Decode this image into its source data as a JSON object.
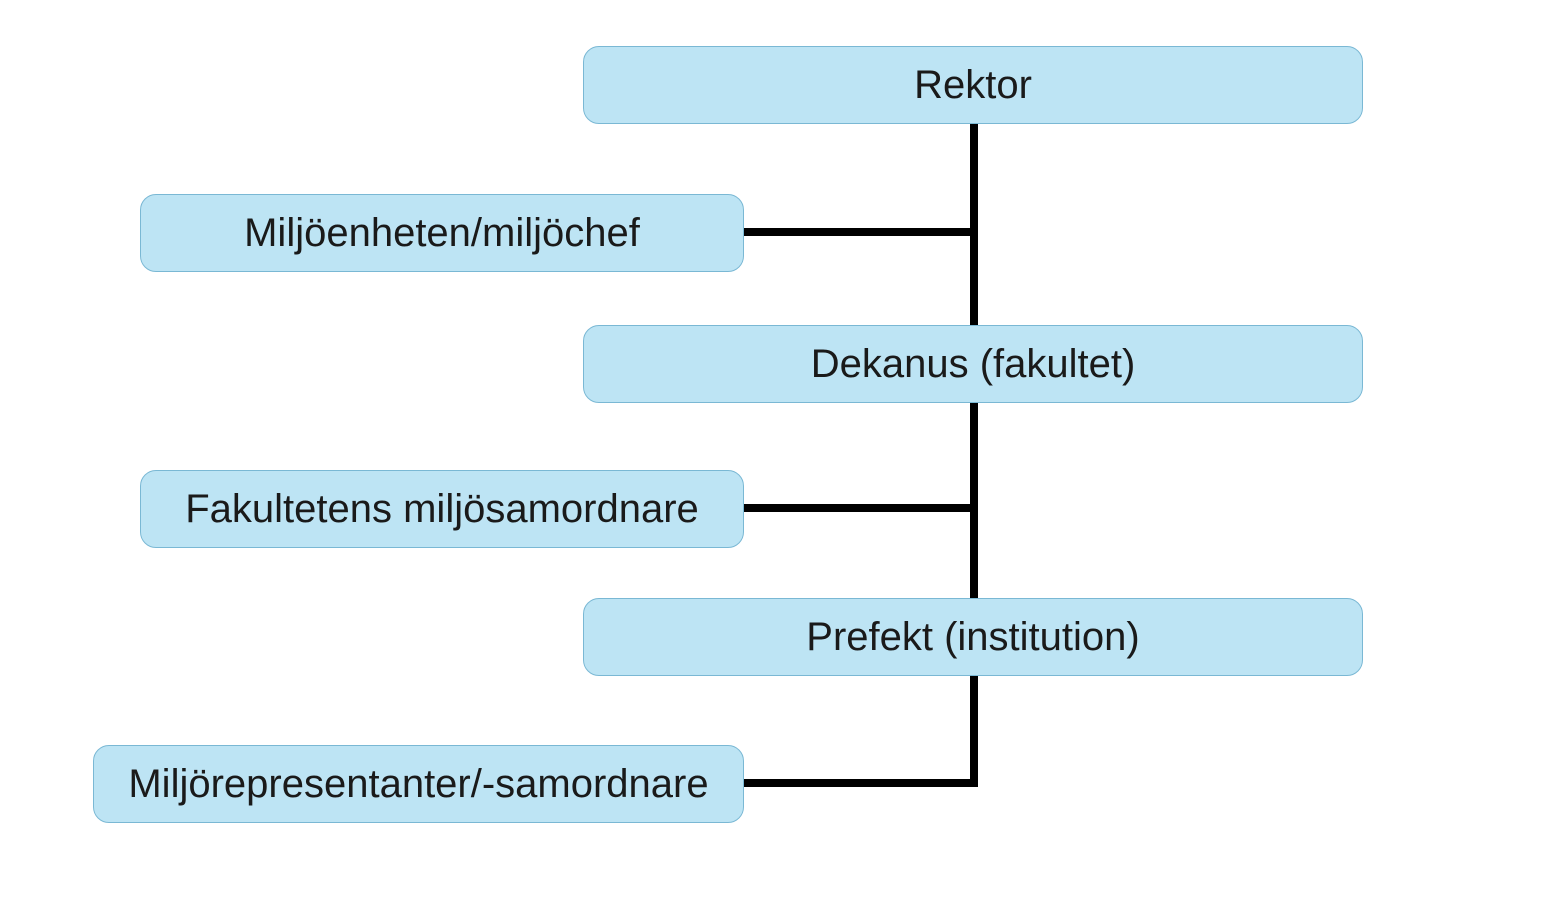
{
  "diagram": {
    "nodes": {
      "rektor": {
        "label": "Rektor"
      },
      "miljochef": {
        "label": "Miljöenheten/miljöchef"
      },
      "dekanus": {
        "label": "Dekanus (fakultet)"
      },
      "fakms": {
        "label": "Fakultetens miljösamordnare"
      },
      "prefekt": {
        "label": "Prefekt (institution)"
      },
      "miljrep": {
        "label": "Miljörepresentanter/-samordnare"
      }
    },
    "edges": [
      [
        "rektor",
        "dekanus"
      ],
      [
        "rektor",
        "miljochef"
      ],
      [
        "dekanus",
        "prefekt"
      ],
      [
        "dekanus",
        "fakms"
      ],
      [
        "prefekt",
        "miljrep"
      ]
    ],
    "style": {
      "node_fill": "#bde4f4",
      "node_border": "#7ab8d4",
      "connector": "#000000"
    }
  }
}
